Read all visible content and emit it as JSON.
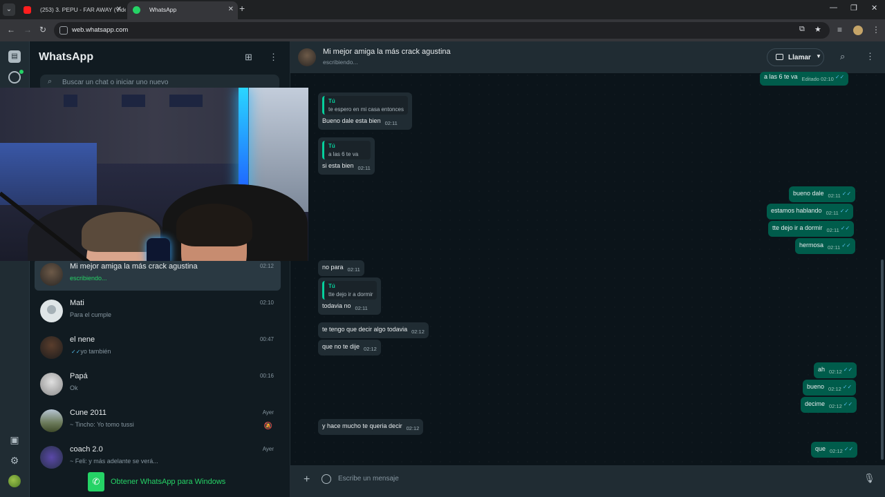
{
  "browser": {
    "tabs": [
      {
        "title": "(253) 3. PEPU - FAR AWAY (Vide",
        "active": false
      },
      {
        "title": "WhatsApp",
        "active": true
      }
    ],
    "url": "web.whatsapp.com"
  },
  "sidebar": {
    "title": "WhatsApp",
    "search_placeholder": "Buscar un chat o iniciar uno nuevo",
    "chats": [
      {
        "name": "Mi mejor amiga la más crack agustina",
        "preview": "escribiendo...",
        "time": "02:12",
        "selected": true
      },
      {
        "name": "Mati",
        "preview": "Para el cumple",
        "time": "02:10"
      },
      {
        "name": "el nene",
        "preview": "yo también",
        "time": "00:47"
      },
      {
        "name": "Papá",
        "preview": "Ok",
        "time": "00:16"
      },
      {
        "name": "Cune 2011",
        "preview": "~ Tincho: Yo tomo tussi",
        "time": "Ayer",
        "muted": true
      },
      {
        "name": "coach 2.0",
        "preview": "~ Feli: y más adelante se verá...",
        "time": "Ayer"
      }
    ],
    "get_app": "Obtener WhatsApp para Windows"
  },
  "conversation": {
    "contact": "Mi mejor amiga la más crack agustina",
    "status": "escribiendo...",
    "call_label": "Llamar",
    "input_placeholder": "Escribe un mensaje",
    "messages": [
      {
        "dir": "out",
        "text": "a las 6 te va",
        "time": "Editado 02:10"
      },
      {
        "dir": "in",
        "quote_name": "Tú",
        "quote_text": "te espero en mi casa entonces",
        "text": "Bueno dale esta bien",
        "time": "02:11"
      },
      {
        "dir": "in",
        "quote_name": "Tú",
        "quote_text": "a las 6 te va",
        "text": "si esta bien",
        "time": "02:11"
      },
      {
        "dir": "out",
        "text": "bueno dale",
        "time": "02:11"
      },
      {
        "dir": "out",
        "text": "estamos hablando",
        "time": "02:11"
      },
      {
        "dir": "out",
        "text": "tte dejo ir a dormir",
        "time": "02:11"
      },
      {
        "dir": "out",
        "text": "hermosa",
        "time": "02:11"
      },
      {
        "dir": "in",
        "text": "no para",
        "time": "02:11"
      },
      {
        "dir": "in",
        "quote_name": "Tú",
        "quote_text": "tte dejo ir a dormir",
        "text": "todavia no",
        "time": "02:11"
      },
      {
        "dir": "in",
        "text": "te tengo que decir algo todavia",
        "time": "02:12"
      },
      {
        "dir": "in",
        "text": "que no te dije",
        "time": "02:12"
      },
      {
        "dir": "out",
        "text": "ah",
        "time": "02:12"
      },
      {
        "dir": "out",
        "text": "bueno",
        "time": "02:12"
      },
      {
        "dir": "out",
        "text": "decime",
        "time": "02:12"
      },
      {
        "dir": "in",
        "text": "y hace mucho te queria decir",
        "time": "02:12"
      },
      {
        "dir": "out",
        "text": "que",
        "time": "02:12"
      }
    ]
  }
}
